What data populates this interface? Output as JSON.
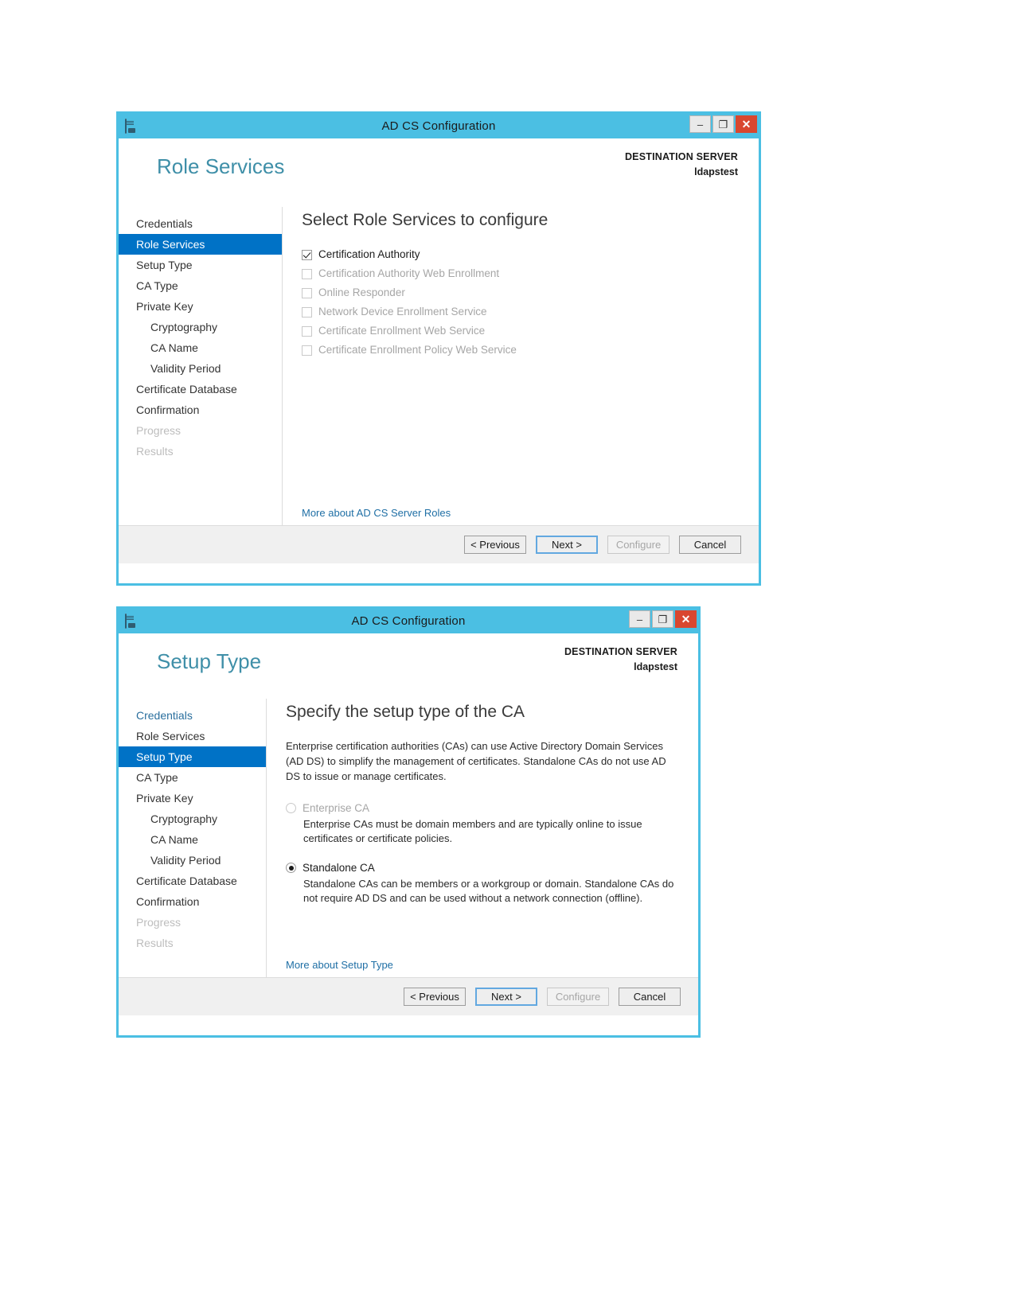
{
  "window1": {
    "title": "AD CS Configuration",
    "icon": "adcs-document-icon",
    "window_buttons": {
      "minimize": "–",
      "maximize": "❐",
      "close": "✕"
    },
    "page_title": "Role Services",
    "destination": {
      "label": "DESTINATION SERVER",
      "server": "ldapstest"
    },
    "nav": [
      {
        "label": "Credentials",
        "state": "normal",
        "indent": false
      },
      {
        "label": "Role Services",
        "state": "active",
        "indent": false
      },
      {
        "label": "Setup Type",
        "state": "normal",
        "indent": false
      },
      {
        "label": "CA Type",
        "state": "normal",
        "indent": false
      },
      {
        "label": "Private Key",
        "state": "normal",
        "indent": false
      },
      {
        "label": "Cryptography",
        "state": "normal",
        "indent": true
      },
      {
        "label": "CA Name",
        "state": "normal",
        "indent": true
      },
      {
        "label": "Validity Period",
        "state": "normal",
        "indent": true
      },
      {
        "label": "Certificate Database",
        "state": "normal",
        "indent": false
      },
      {
        "label": "Confirmation",
        "state": "normal",
        "indent": false
      },
      {
        "label": "Progress",
        "state": "disabled",
        "indent": false
      },
      {
        "label": "Results",
        "state": "disabled",
        "indent": false
      }
    ],
    "heading": "Select Role Services to configure",
    "role_services": [
      {
        "label": "Certification Authority",
        "checked": true,
        "enabled": true
      },
      {
        "label": "Certification Authority Web Enrollment",
        "checked": false,
        "enabled": false
      },
      {
        "label": "Online Responder",
        "checked": false,
        "enabled": false
      },
      {
        "label": "Network Device Enrollment Service",
        "checked": false,
        "enabled": false
      },
      {
        "label": "Certificate Enrollment Web Service",
        "checked": false,
        "enabled": false
      },
      {
        "label": "Certificate Enrollment Policy Web Service",
        "checked": false,
        "enabled": false
      }
    ],
    "more_link": "More about AD CS Server Roles",
    "buttons": {
      "previous": "< Previous",
      "next": "Next >",
      "configure": "Configure",
      "cancel": "Cancel"
    }
  },
  "window2": {
    "title": "AD CS Configuration",
    "icon": "adcs-document-icon",
    "window_buttons": {
      "minimize": "–",
      "maximize": "❐",
      "close": "✕"
    },
    "page_title": "Setup Type",
    "destination": {
      "label": "DESTINATION SERVER",
      "server": "ldapstest"
    },
    "nav": [
      {
        "label": "Credentials",
        "state": "link",
        "indent": false
      },
      {
        "label": "Role Services",
        "state": "normal",
        "indent": false
      },
      {
        "label": "Setup Type",
        "state": "active",
        "indent": false
      },
      {
        "label": "CA Type",
        "state": "normal",
        "indent": false
      },
      {
        "label": "Private Key",
        "state": "normal",
        "indent": false
      },
      {
        "label": "Cryptography",
        "state": "normal",
        "indent": true
      },
      {
        "label": "CA Name",
        "state": "normal",
        "indent": true
      },
      {
        "label": "Validity Period",
        "state": "normal",
        "indent": true
      },
      {
        "label": "Certificate Database",
        "state": "normal",
        "indent": false
      },
      {
        "label": "Confirmation",
        "state": "normal",
        "indent": false
      },
      {
        "label": "Progress",
        "state": "disabled",
        "indent": false
      },
      {
        "label": "Results",
        "state": "disabled",
        "indent": false
      }
    ],
    "heading": "Specify the setup type of the CA",
    "description": "Enterprise certification authorities (CAs) can use Active Directory Domain Services (AD DS) to simplify the management of certificates. Standalone CAs do not use AD DS to issue or manage certificates.",
    "options": [
      {
        "label": "Enterprise CA",
        "selected": false,
        "enabled": false,
        "description": "Enterprise CAs must be domain members and are typically online to issue certificates or certificate policies."
      },
      {
        "label": "Standalone CA",
        "selected": true,
        "enabled": true,
        "description": "Standalone CAs can be members or a workgroup or domain. Standalone CAs do not require AD DS and can be used without a network connection (offline)."
      }
    ],
    "more_link": "More about Setup Type",
    "buttons": {
      "previous": "< Previous",
      "next": "Next >",
      "configure": "Configure",
      "cancel": "Cancel"
    }
  },
  "colors": {
    "titlebar": "#4bbfe3",
    "accent_nav": "#0072c6",
    "close_button": "#d9472f",
    "heading_teal": "#3f8fa8",
    "link": "#1f6fa5"
  }
}
